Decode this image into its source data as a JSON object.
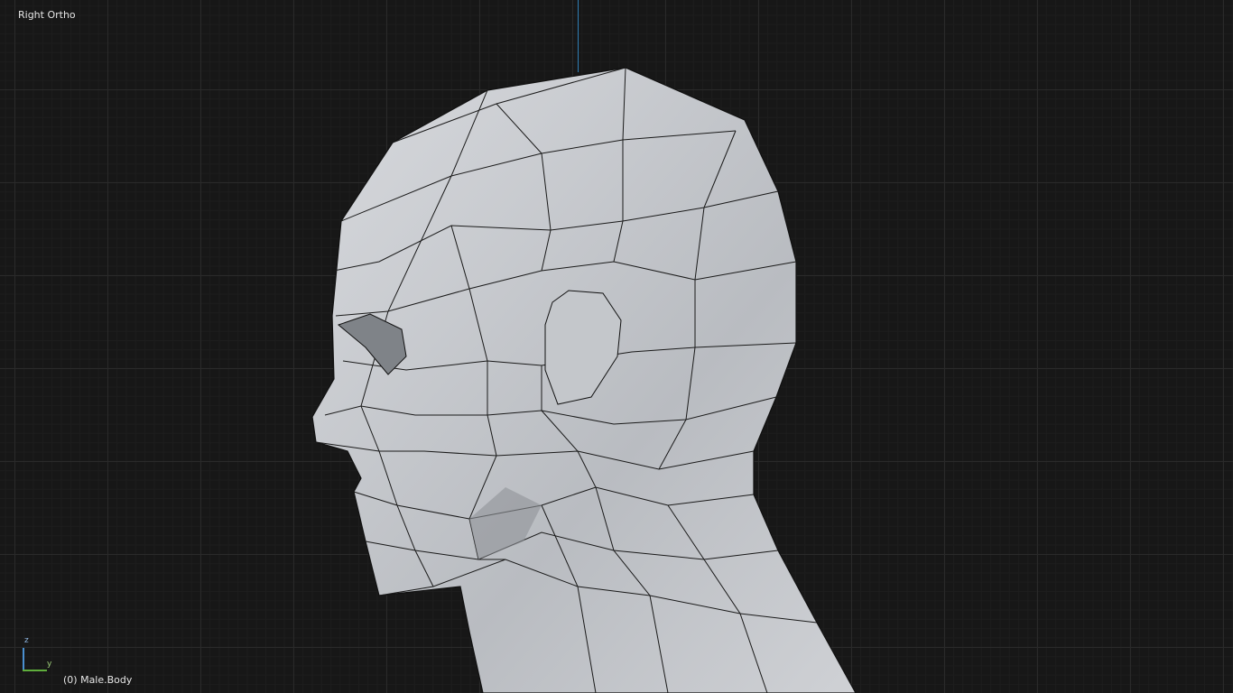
{
  "viewport": {
    "view_name": "Right Ortho",
    "object_info": "(0) Male.Body"
  },
  "axis_gizmo": {
    "z_label": "z",
    "y_label": "y",
    "z_color": "#4a8fd0",
    "y_color": "#5fae3c"
  }
}
